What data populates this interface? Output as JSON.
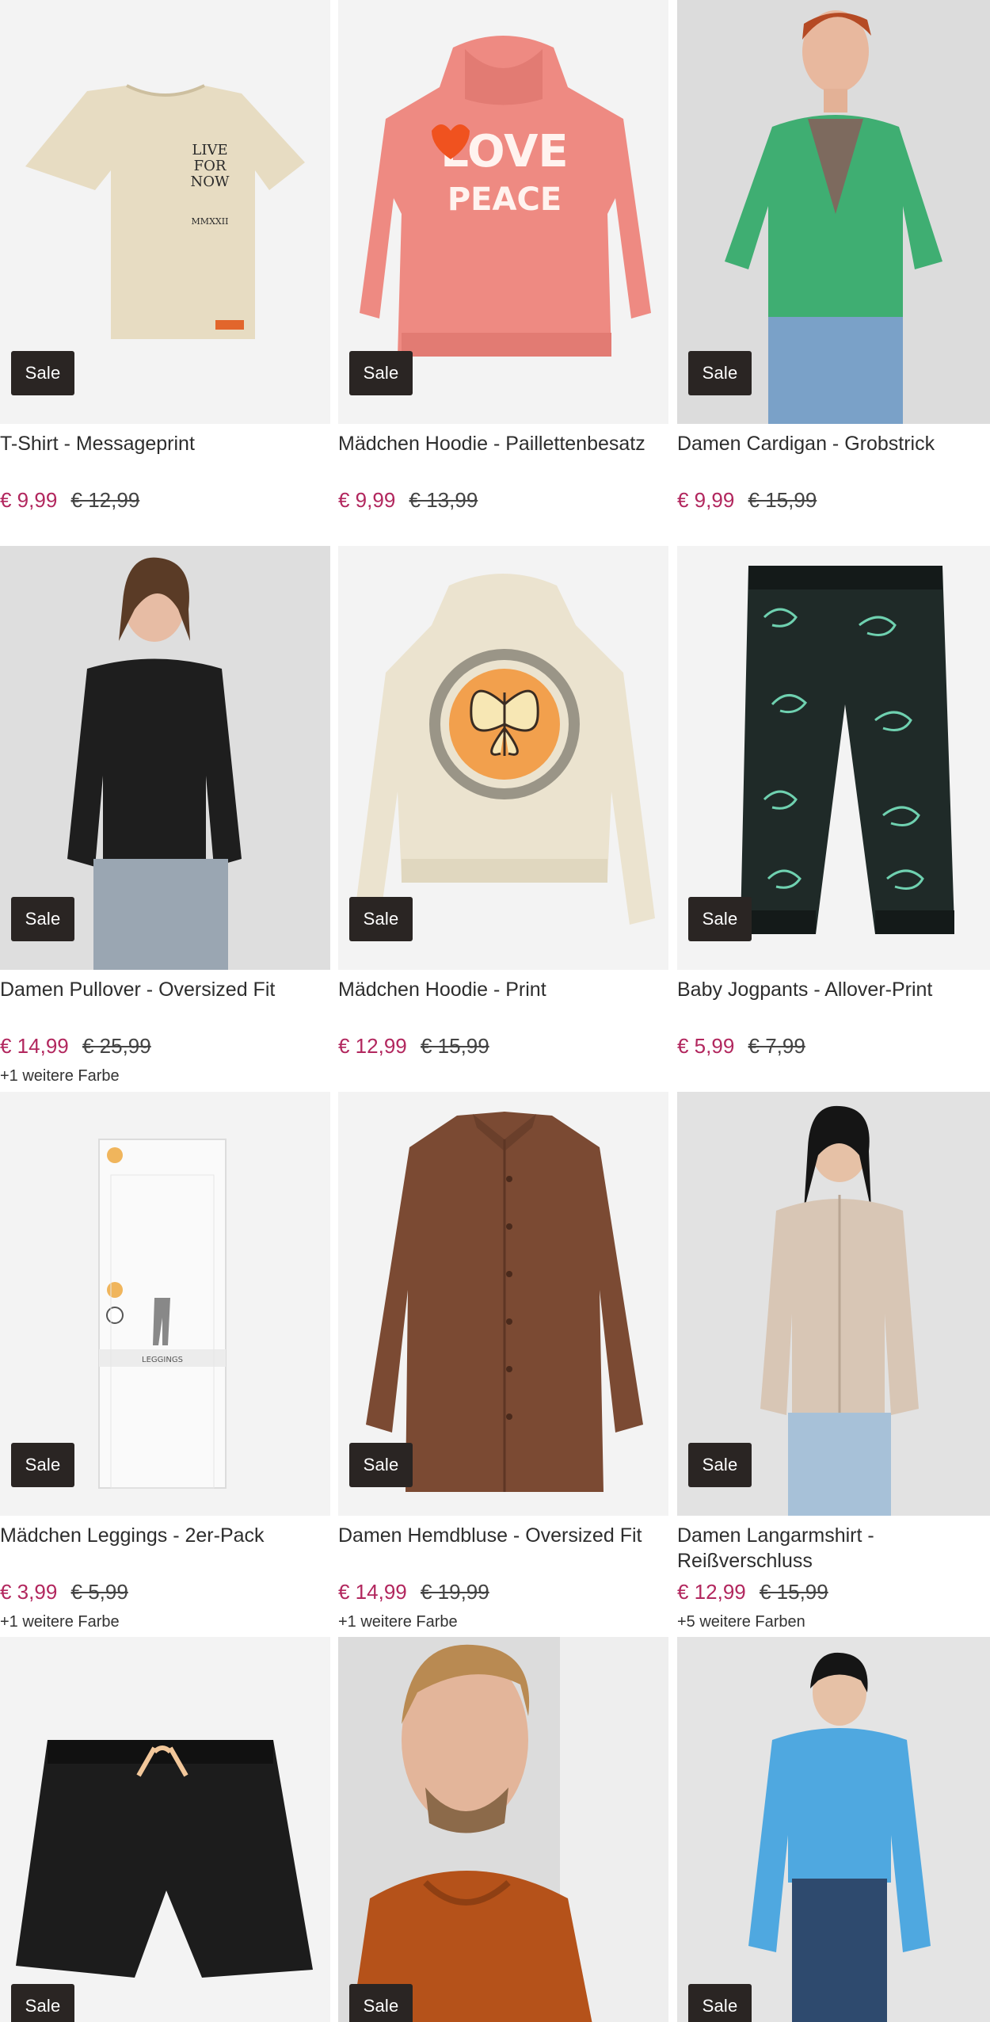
{
  "sale_label": "Sale",
  "colors": {
    "price_now": "#b2275e",
    "sale_badge": "#2a2523"
  },
  "products": [
    {
      "name": "T-Shirt - Messageprint",
      "price_now": "€ 9,99",
      "price_old": "€ 12,99",
      "more_colors": "",
      "image": "beige-tshirt-live-for-now"
    },
    {
      "name": "Mädchen Hoodie - Paillettenbesatz",
      "price_now": "€ 9,99",
      "price_old": "€ 13,99",
      "more_colors": "",
      "image": "pink-hoodie-love-peace"
    },
    {
      "name": "Damen Cardigan - Grobstrick",
      "price_now": "€ 9,99",
      "price_old": "€ 15,99",
      "more_colors": "",
      "image": "green-cardigan-model"
    },
    {
      "name": "Damen Pullover - Oversized Fit",
      "price_now": "€ 14,99",
      "price_old": "€ 25,99",
      "more_colors": "+1 weitere Farbe",
      "image": "black-pullover-model"
    },
    {
      "name": "Mädchen Hoodie - Print",
      "price_now": "€ 12,99",
      "price_old": "€ 15,99",
      "more_colors": "",
      "image": "beige-hoodie-butterfly"
    },
    {
      "name": "Baby Jogpants - Allover-Print",
      "price_now": "€ 5,99",
      "price_old": "€ 7,99",
      "more_colors": "",
      "image": "black-jogpants-dino"
    },
    {
      "name": "Mädchen Leggings - 2er-Pack",
      "price_now": "€ 3,99",
      "price_old": "€ 5,99",
      "more_colors": "+1 weitere Farbe",
      "image": "white-leggings-pack"
    },
    {
      "name": "Damen Hemdbluse - Oversized Fit",
      "price_now": "€ 14,99",
      "price_old": "€ 19,99",
      "more_colors": "+1 weitere Farbe",
      "image": "brown-shirt-blouse"
    },
    {
      "name": "Damen Langarmshirt - Reißverschluss",
      "price_now": "€ 12,99",
      "price_old": "€ 15,99",
      "more_colors": "+5 weitere Farben",
      "image": "beige-zip-top-model"
    },
    {
      "name": "",
      "price_now": "",
      "price_old": "",
      "more_colors": "",
      "image": "black-shorts"
    },
    {
      "name": "",
      "price_now": "",
      "price_old": "",
      "more_colors": "",
      "image": "orange-hoodie-man"
    },
    {
      "name": "",
      "price_now": "",
      "price_old": "",
      "more_colors": "",
      "image": "blue-knit-model"
    }
  ]
}
